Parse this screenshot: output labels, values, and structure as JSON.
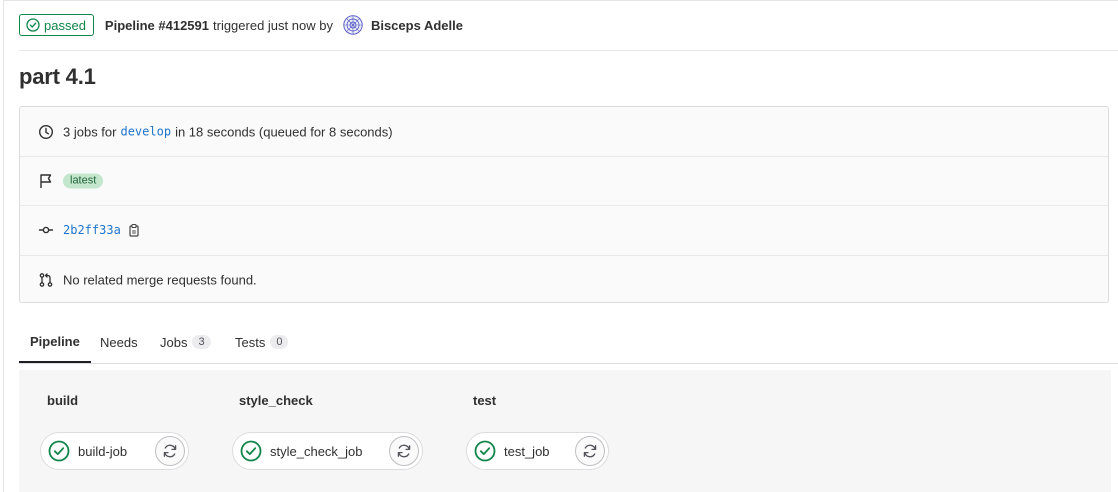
{
  "header": {
    "status_label": "passed",
    "pipeline_label": "Pipeline #412591",
    "triggered_text": "triggered just now by",
    "author_name": "Bisceps Adelle"
  },
  "page": {
    "title": "part 4.1"
  },
  "info": {
    "jobs_prefix": "3 jobs for",
    "branch": "develop",
    "duration_text": "in 18 seconds (queued for 8 seconds)",
    "badge": "latest",
    "commit_sha": "2b2ff33a",
    "merge_requests_text": "No related merge requests found."
  },
  "tabs": [
    {
      "label": "Pipeline",
      "active": true
    },
    {
      "label": "Needs"
    },
    {
      "label": "Jobs",
      "count": "3"
    },
    {
      "label": "Tests",
      "count": "0"
    }
  ],
  "stages": [
    {
      "title": "build",
      "jobs": [
        {
          "name": "build-job",
          "status": "passed"
        }
      ]
    },
    {
      "title": "style_check",
      "jobs": [
        {
          "name": "style_check_job",
          "status": "passed"
        }
      ]
    },
    {
      "title": "test",
      "jobs": [
        {
          "name": "test_job",
          "status": "passed"
        }
      ]
    }
  ],
  "icons": {
    "status": "check-circle-icon",
    "retry": "retry-icon",
    "duration": "clock-icon",
    "badge_row": "flag-icon",
    "commit": "commit-icon",
    "merge": "merge-request-icon",
    "copy": "copy-to-clipboard-icon"
  },
  "colors": {
    "success": "#108548",
    "link": "#1f75cb",
    "latest_badge_bg": "#c3e6cd"
  }
}
